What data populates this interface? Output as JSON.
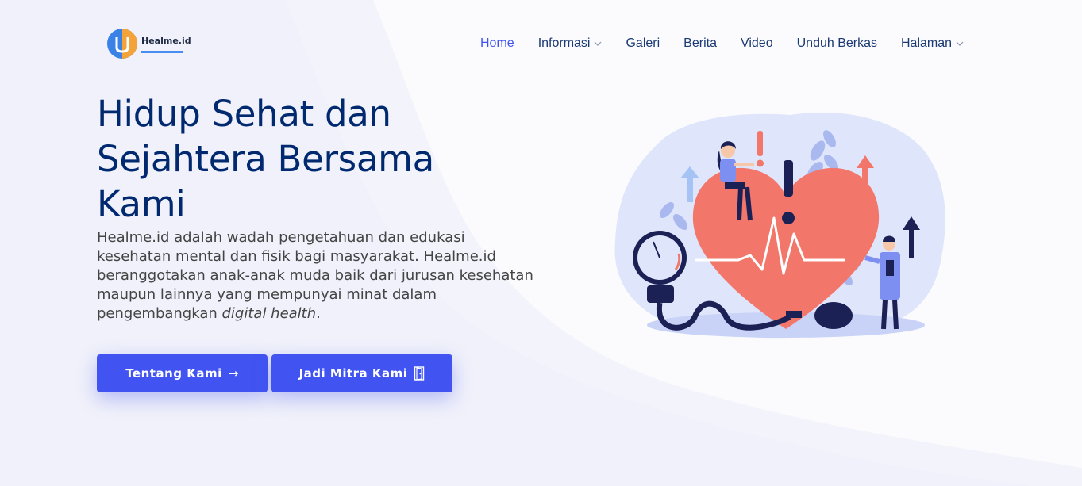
{
  "brand": {
    "name": "Healme.id"
  },
  "nav": {
    "items": [
      {
        "label": "Home",
        "active": true,
        "dropdown": false
      },
      {
        "label": "Informasi",
        "active": false,
        "dropdown": true
      },
      {
        "label": "Galeri",
        "active": false,
        "dropdown": false
      },
      {
        "label": "Berita",
        "active": false,
        "dropdown": false
      },
      {
        "label": "Video",
        "active": false,
        "dropdown": false
      },
      {
        "label": "Unduh Berkas",
        "active": false,
        "dropdown": false
      },
      {
        "label": "Halaman",
        "active": false,
        "dropdown": true
      }
    ]
  },
  "hero": {
    "title": "Hidup Sehat dan Sejahtera Bersama Kami",
    "description_main": "Healme.id adalah wadah pengetahuan dan edukasi kesehatan mental dan fisik bagi masyarakat. Healme.id beranggotakan anak-anak muda baik dari jurusan kesehatan maupun lainnya yang mempunyai minat dalam pengembangkan ",
    "description_emphasis": "digital health",
    "description_end": ".",
    "buttons": {
      "about": {
        "label": "Tentang Kami",
        "icon": "arrow-right-icon",
        "glyph": "→"
      },
      "partner": {
        "label": "Jadi Mitra Kami",
        "icon": "door-open-icon"
      }
    }
  },
  "colors": {
    "primary": "#4154f1",
    "heading": "#012970",
    "nav_text": "#1b3a73",
    "body_text": "#444444",
    "heart": "#f2766a",
    "illustration_bg": "#dfe5fb"
  }
}
